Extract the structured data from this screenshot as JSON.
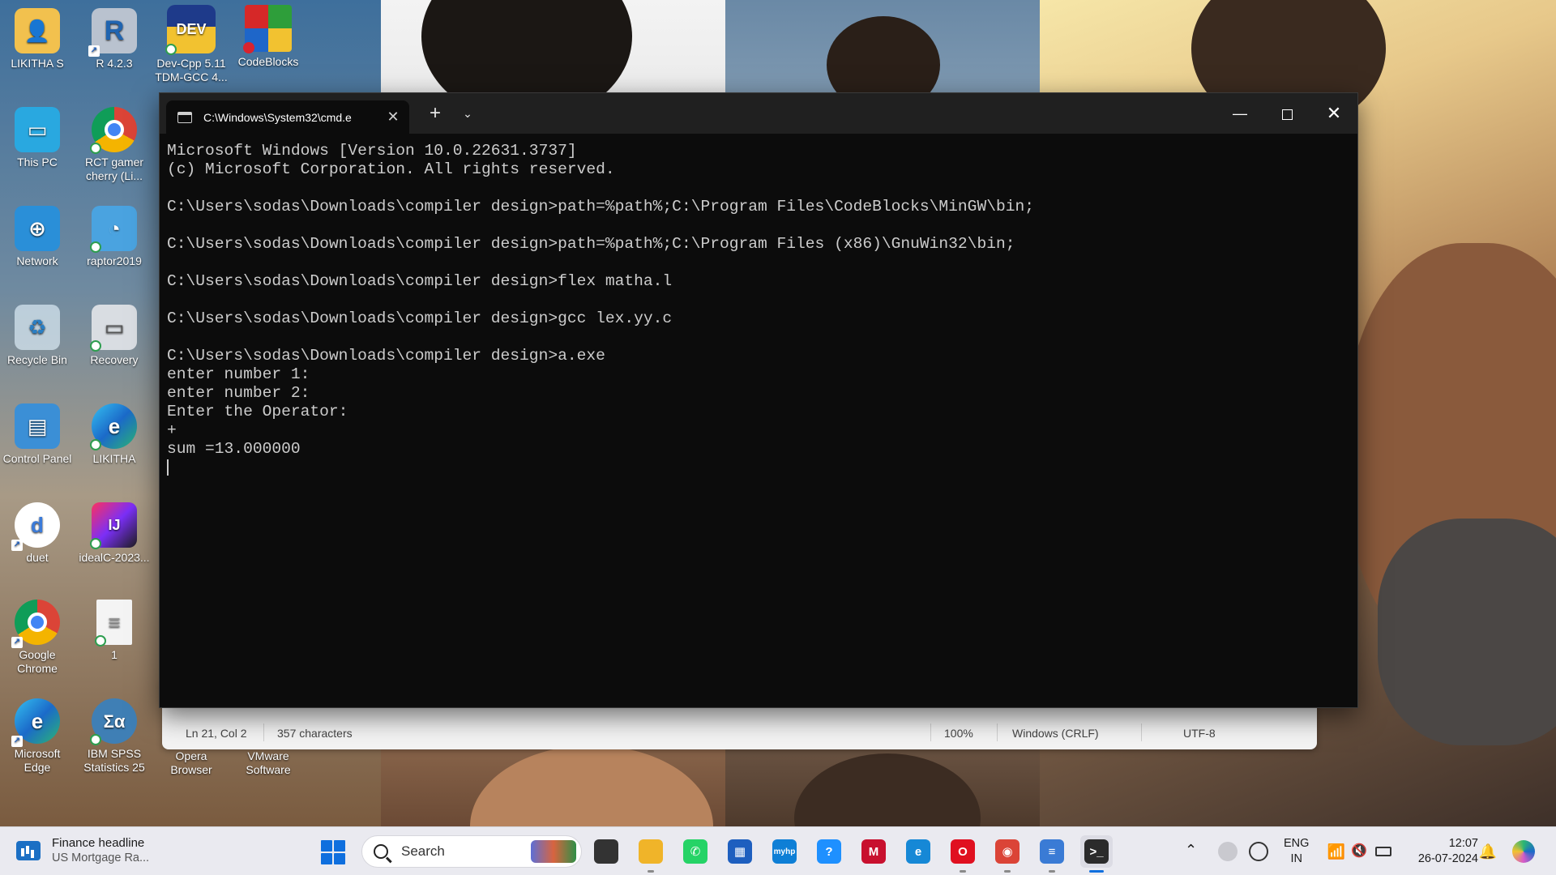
{
  "desktop": {
    "icons": [
      {
        "label": "LIKITHA S",
        "icon": "folder-user-icon"
      },
      {
        "label": "R 4.2.3",
        "icon": "r-language-icon"
      },
      {
        "label": "Dev-Cpp 5.11 TDM-GCC 4...",
        "icon": "devcpp-icon"
      },
      {
        "label": "CodeBlocks",
        "icon": "codeblocks-icon"
      },
      {
        "label": "This PC",
        "icon": "monitor-icon"
      },
      {
        "label": "RCT gamer cherry (Li...",
        "icon": "chrome-icon"
      },
      {
        "label": "Network",
        "icon": "network-icon"
      },
      {
        "label": "raptor2019",
        "icon": "raptor-icon"
      },
      {
        "label": "Recycle Bin",
        "icon": "recycle-bin-icon"
      },
      {
        "label": "Recovery",
        "icon": "recovery-icon"
      },
      {
        "label": "Control Panel",
        "icon": "control-panel-icon"
      },
      {
        "label": "LIKITHA",
        "icon": "edge-icon"
      },
      {
        "label": "duet",
        "icon": "duet-icon"
      },
      {
        "label": "idealC-2023...",
        "icon": "intellij-icon"
      },
      {
        "label": "Google Chrome",
        "icon": "chrome-icon"
      },
      {
        "label": "1",
        "icon": "document-icon"
      },
      {
        "label": "Microsoft Edge",
        "icon": "edge-icon"
      },
      {
        "label": "IBM SPSS Statistics 25",
        "icon": "spss-icon"
      },
      {
        "label": "Opera Browser",
        "icon": "opera-icon"
      },
      {
        "label": "VMware Software",
        "icon": "vmware-icon"
      }
    ]
  },
  "notepad": {
    "position": "Ln 21, Col 2",
    "characters": "357 characters",
    "zoom": "100%",
    "line_ending": "Windows (CRLF)",
    "encoding": "UTF-8"
  },
  "terminal": {
    "tab_title": "C:\\Windows\\System32\\cmd.e",
    "tab_close": "✕",
    "new_tab": "+",
    "dropdown": "⌄",
    "minimize": "—",
    "close": "✕",
    "lines": [
      "Microsoft Windows [Version 10.0.22631.3737]",
      "(c) Microsoft Corporation. All rights reserved.",
      "",
      "C:\\Users\\sodas\\Downloads\\compiler design>path=%path%;C:\\Program Files\\CodeBlocks\\MinGW\\bin;",
      "",
      "C:\\Users\\sodas\\Downloads\\compiler design>path=%path%;C:\\Program Files (x86)\\GnuWin32\\bin;",
      "",
      "C:\\Users\\sodas\\Downloads\\compiler design>flex matha.l",
      "",
      "C:\\Users\\sodas\\Downloads\\compiler design>gcc lex.yy.c",
      "",
      "C:\\Users\\sodas\\Downloads\\compiler design>a.exe",
      "enter number 1:",
      "enter number 2:",
      "Enter the Operator:",
      "+",
      "sum =13.000000"
    ]
  },
  "taskbar": {
    "widget_title": "Finance headline",
    "widget_sub": "US Mortgage Ra...",
    "search_placeholder": "Search",
    "apps": [
      {
        "name": "task-view",
        "color": "#333333",
        "glyph": ""
      },
      {
        "name": "file-explorer",
        "color": "#f0b429",
        "glyph": ""
      },
      {
        "name": "whatsapp",
        "color": "#25d366",
        "glyph": "✆"
      },
      {
        "name": "microsoft-store",
        "color": "#1e5fbf",
        "glyph": "▦"
      },
      {
        "name": "myhp",
        "color": "#0e7fd6",
        "glyph": "myhp"
      },
      {
        "name": "hp-support",
        "color": "#1e90ff",
        "glyph": "?"
      },
      {
        "name": "mcafee",
        "color": "#c8102e",
        "glyph": "M"
      },
      {
        "name": "edge",
        "color": "#1688d6",
        "glyph": "e"
      },
      {
        "name": "opera",
        "color": "#e01020",
        "glyph": "O"
      },
      {
        "name": "chrome",
        "color": "#db4437",
        "glyph": "◉"
      },
      {
        "name": "notepad",
        "color": "#3a7bd5",
        "glyph": "≡"
      },
      {
        "name": "terminal",
        "color": "#2b2b2b",
        "glyph": ">_"
      }
    ],
    "language": "ENG",
    "region": "IN",
    "time": "12:07",
    "date": "26-07-2024"
  }
}
